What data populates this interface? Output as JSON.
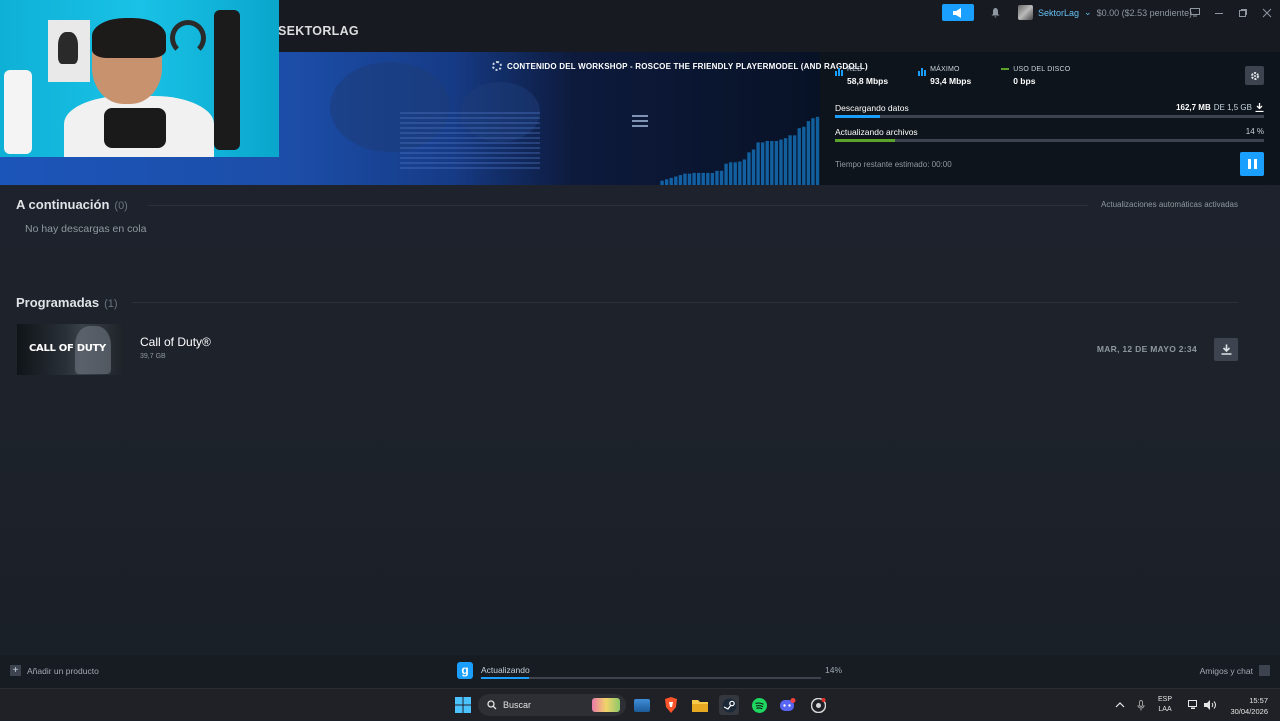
{
  "titlebar": {
    "brand": "SEKTORLAG",
    "account_name": "SektorLag",
    "account_caret": "⌄",
    "balance": "$0.00 ($2.53 pendiente)"
  },
  "banner": {
    "title": "CONTENIDO DEL WORKSHOP - ROSCOE THE FRIENDLY PLAYERMODEL (AND RAGDOLL)",
    "stats": [
      {
        "label": "RED",
        "value": "58,8 Mbps",
        "icon": "bars-icon",
        "color": "#1a9fff"
      },
      {
        "label": "MÁXIMO",
        "value": "93,4 Mbps",
        "icon": "bars-icon",
        "color": "#1a9fff"
      },
      {
        "label": "USO DEL DISCO",
        "value": "0 bps",
        "icon": "dash-icon",
        "color": "#5ba32b"
      }
    ],
    "downloading_label": "Descargando datos",
    "downloaded": "162,7 MB",
    "downloaded_of": "DE 1,5 GB",
    "downloading_progress": 0.106,
    "updating_label": "Actualizando archivos",
    "updating_pct": "14 %",
    "updating_progress": 0.14,
    "eta": "Tiempo restante estimado: 00:00",
    "graph_levels": [
      0.06,
      0.08,
      0.1,
      0.12,
      0.14,
      0.16,
      0.16,
      0.17,
      0.17,
      0.17,
      0.17,
      0.17,
      0.2,
      0.2,
      0.3,
      0.32,
      0.32,
      0.33,
      0.36,
      0.46,
      0.5,
      0.6,
      0.6,
      0.62,
      0.62,
      0.62,
      0.64,
      0.66,
      0.7,
      0.7,
      0.8,
      0.82,
      0.9,
      0.94,
      0.96
    ],
    "accent": "#1a9fff",
    "disk_color": "#5ba32b"
  },
  "queue": {
    "title": "A continuación",
    "count": "(0)",
    "auto_updates": "Actualizaciones automáticas activadas",
    "empty": "No hay descargas en cola"
  },
  "scheduled": {
    "title": "Programadas",
    "count": "(1)",
    "items": [
      {
        "thumb_logo": "CALL OF DUTY",
        "name": "Call of Duty®",
        "size": "39,7 GB",
        "date": "MAR, 12 DE MAYO 2:34"
      }
    ]
  },
  "footer": {
    "add_product": "Añadir un producto",
    "game_icon_letter": "g",
    "status": "Actualizando",
    "pct": "14%",
    "progress": 0.14,
    "friends": "Amigos y chat"
  },
  "taskbar": {
    "search_placeholder": "Buscar",
    "lang_line1": "ESP",
    "lang_line2": "LAA",
    "time": "15:57",
    "date": "30/04/2026",
    "apps": [
      "windows-start-icon",
      "photo-widget-icon",
      "browser-store-icon",
      "brave-browser-icon",
      "file-explorer-icon",
      "steam-icon",
      "spotify-icon",
      "discord-icon",
      "chrome-icon"
    ]
  }
}
